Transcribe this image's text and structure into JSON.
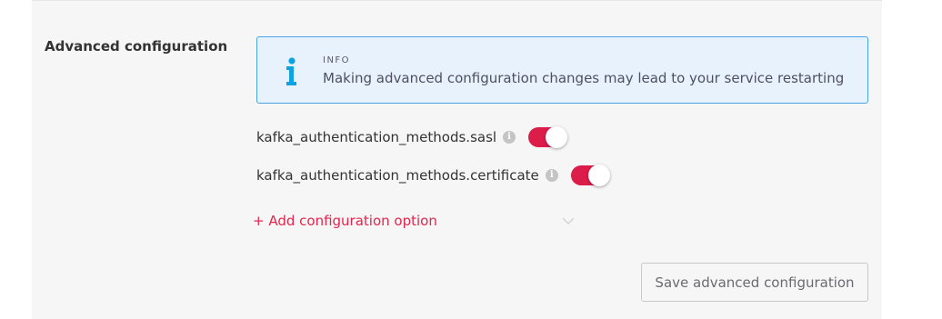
{
  "section": {
    "title": "Advanced configuration"
  },
  "info": {
    "label": "INFO",
    "message": "Making advanced configuration changes may lead to your service restarting",
    "icon": "info-icon",
    "color": "#0da2e2"
  },
  "options": [
    {
      "label": "kafka_authentication_methods.sasl",
      "enabled": true
    },
    {
      "label": "kafka_authentication_methods.certificate",
      "enabled": true
    }
  ],
  "help_icon_glyph": "i",
  "add_option": {
    "label": "+ Add configuration option"
  },
  "save_button": {
    "label": "Save advanced configuration"
  },
  "colors": {
    "accent": "#dc1d4a",
    "info_border": "#4aa3e6",
    "info_bg": "#e8f2fd"
  }
}
